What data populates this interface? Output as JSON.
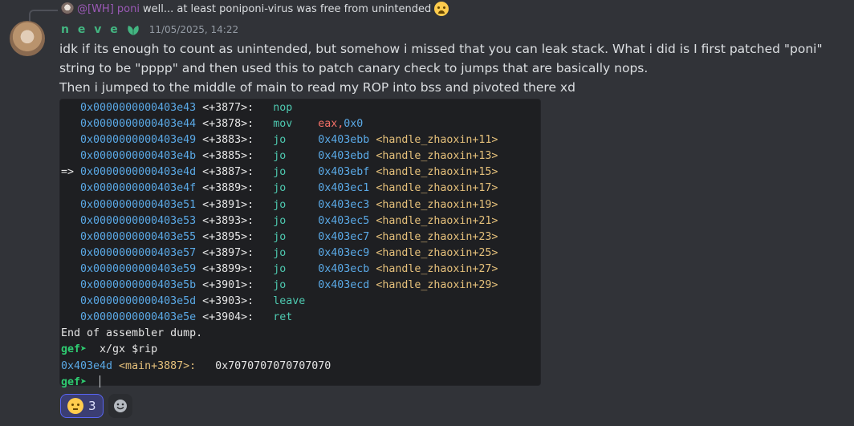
{
  "reply": {
    "author": "@[WH] poni",
    "text": "well... at least poniponi-virus was free from unintended"
  },
  "message": {
    "author": "n e v e",
    "timestamp": "11/05/2025, 14:22",
    "paragraphs": [
      "idk if its enough to count as unintended, but somehow i missed that you can leak stack. What i did is I first patched \"poni\" string to be \"pppp\" and then used this to patch canary check to jumps that are basically nops.",
      "Then i jumped to the middle of main to read my ROP into bss and pivoted there xd"
    ]
  },
  "code": {
    "asm": [
      {
        "arrow": "  ",
        "addr": "0x0000000000403e43",
        "off": "<+3877>:",
        "mnem": "nop",
        "op": "",
        "target": "",
        "sym": ""
      },
      {
        "arrow": "  ",
        "addr": "0x0000000000403e44",
        "off": "<+3878>:",
        "mnem": "mov",
        "op": "eax,",
        "target": "0x0",
        "sym": ""
      },
      {
        "arrow": "  ",
        "addr": "0x0000000000403e49",
        "off": "<+3883>:",
        "mnem": "jo",
        "op": "",
        "target": "0x403ebb",
        "sym": "<handle_zhaoxin+11>"
      },
      {
        "arrow": "  ",
        "addr": "0x0000000000403e4b",
        "off": "<+3885>:",
        "mnem": "jo",
        "op": "",
        "target": "0x403ebd",
        "sym": "<handle_zhaoxin+13>"
      },
      {
        "arrow": "=>",
        "addr": "0x0000000000403e4d",
        "off": "<+3887>:",
        "mnem": "jo",
        "op": "",
        "target": "0x403ebf",
        "sym": "<handle_zhaoxin+15>"
      },
      {
        "arrow": "  ",
        "addr": "0x0000000000403e4f",
        "off": "<+3889>:",
        "mnem": "jo",
        "op": "",
        "target": "0x403ec1",
        "sym": "<handle_zhaoxin+17>"
      },
      {
        "arrow": "  ",
        "addr": "0x0000000000403e51",
        "off": "<+3891>:",
        "mnem": "jo",
        "op": "",
        "target": "0x403ec3",
        "sym": "<handle_zhaoxin+19>"
      },
      {
        "arrow": "  ",
        "addr": "0x0000000000403e53",
        "off": "<+3893>:",
        "mnem": "jo",
        "op": "",
        "target": "0x403ec5",
        "sym": "<handle_zhaoxin+21>"
      },
      {
        "arrow": "  ",
        "addr": "0x0000000000403e55",
        "off": "<+3895>:",
        "mnem": "jo",
        "op": "",
        "target": "0x403ec7",
        "sym": "<handle_zhaoxin+23>"
      },
      {
        "arrow": "  ",
        "addr": "0x0000000000403e57",
        "off": "<+3897>:",
        "mnem": "jo",
        "op": "",
        "target": "0x403ec9",
        "sym": "<handle_zhaoxin+25>"
      },
      {
        "arrow": "  ",
        "addr": "0x0000000000403e59",
        "off": "<+3899>:",
        "mnem": "jo",
        "op": "",
        "target": "0x403ecb",
        "sym": "<handle_zhaoxin+27>"
      },
      {
        "arrow": "  ",
        "addr": "0x0000000000403e5b",
        "off": "<+3901>:",
        "mnem": "jo",
        "op": "",
        "target": "0x403ecd",
        "sym": "<handle_zhaoxin+29>"
      },
      {
        "arrow": "  ",
        "addr": "0x0000000000403e5d",
        "off": "<+3903>:",
        "mnem": "leave",
        "op": "",
        "target": "",
        "sym": ""
      },
      {
        "arrow": "  ",
        "addr": "0x0000000000403e5e",
        "off": "<+3904>:",
        "mnem": "ret",
        "op": "",
        "target": "",
        "sym": ""
      }
    ],
    "end_text": "End of assembler dump.",
    "prompt": "gef➤",
    "command": "x/gx $rip",
    "result_addr": "0x403e4d",
    "result_sym": "<main+3887>:",
    "result_value": "0x7070707070707070"
  },
  "reactions": [
    {
      "emoji": "saluting-face-emoji",
      "count": "3",
      "active": true
    }
  ],
  "colors": {
    "background": "#313338",
    "code_bg": "#1e1f22",
    "username": "#43b581",
    "reply_author": "#9b59b6",
    "address": "#5aa9e6",
    "mnemonic": "#4ec9b0",
    "register": "#f47067",
    "symbol": "#e5c07b",
    "prompt": "#2ecc71"
  },
  "icons": {
    "reply_emoji": "loudly-crying-face-emoji",
    "badge": "leaf-badge-icon",
    "add_reaction": "smiley-add-reaction-icon"
  }
}
